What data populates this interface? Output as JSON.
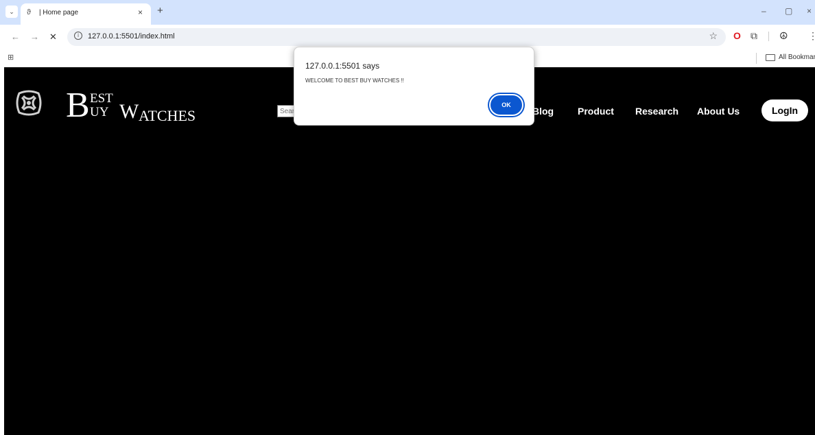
{
  "browser": {
    "tab": {
      "favicon": "ϑ",
      "title": "| Home page",
      "close": "×"
    },
    "new_tab": "+",
    "tab_search": "⌄",
    "window_controls": {
      "minimize": "–",
      "restore": "▢",
      "close": "×"
    },
    "nav": {
      "back": "←",
      "forward": "→",
      "stop": "✕"
    },
    "url": "127.0.0.1:5501/index.html",
    "bookmarks": {
      "all_bookmarks": "All Bookmarks"
    },
    "icons": {
      "info": "i",
      "star": "☆",
      "opera": "O",
      "extensions": "⧉",
      "profile": "☮",
      "menu": "⋮",
      "apps": "⊞"
    }
  },
  "site": {
    "logo": {
      "big_b1": "B",
      "small_est": "EST",
      "big_b2": "B",
      "small_uy": "UY",
      "word_w": "W",
      "word_atches": "ATCHES"
    },
    "search_placeholder": "Search",
    "nav_links": [
      "Blog",
      "Product",
      "Research",
      "About Us"
    ],
    "login_label": "LogIn"
  },
  "alert": {
    "title": "127.0.0.1:5501 says",
    "message": "WELCOME TO BEST BUY WATCHES !!",
    "ok_label": "OK"
  },
  "colors": {
    "tabstrip_bg": "#d3e3fd",
    "page_bg": "#000000",
    "ok_button": "#0b57d0",
    "opera_red": "#e01b22"
  }
}
